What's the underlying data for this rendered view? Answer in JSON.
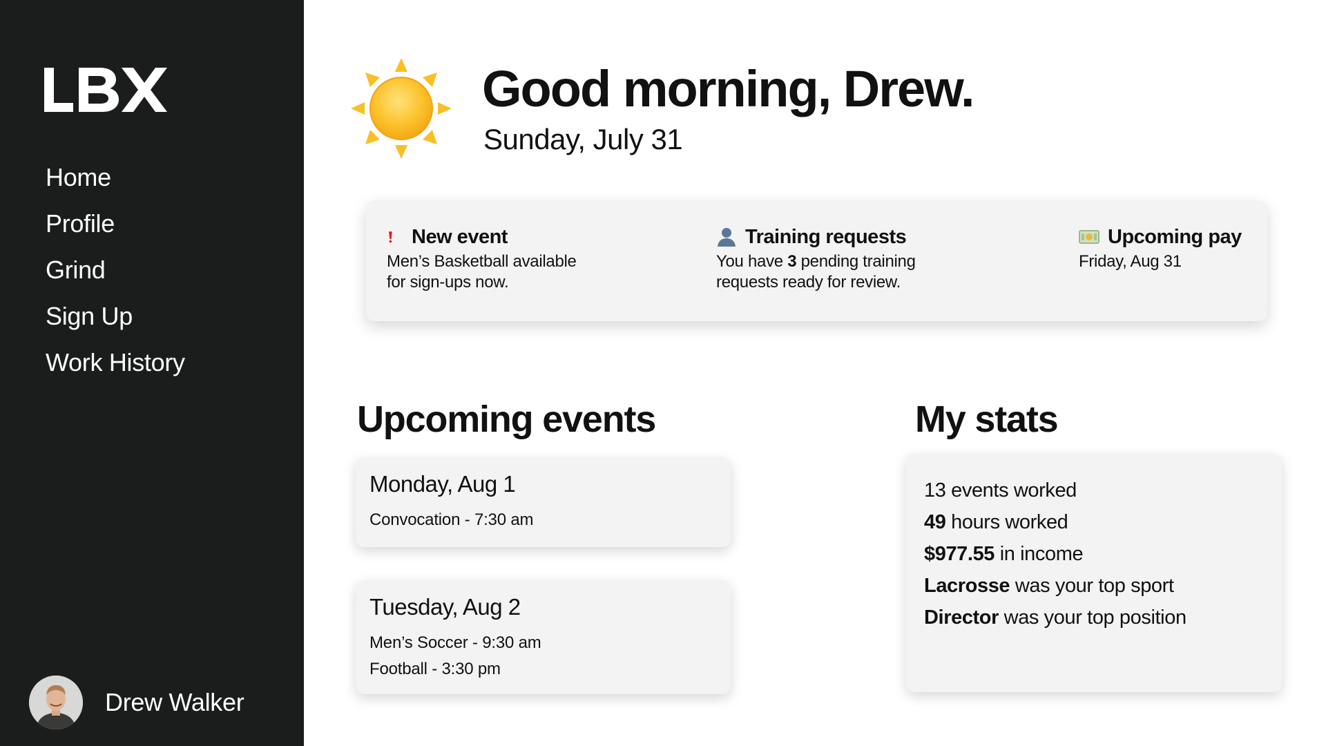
{
  "sidebar": {
    "logo": "LBX",
    "nav": [
      {
        "label": "Home",
        "icon": ""
      },
      {
        "label": "Profile",
        "icon": ""
      },
      {
        "label": "Grind",
        "icon": ""
      },
      {
        "label": "Sign Up",
        "icon": ""
      },
      {
        "label": "Work History",
        "icon": ""
      }
    ],
    "user": {
      "name": "Drew Walker",
      "avatar_icon": "user-avatar"
    }
  },
  "header": {
    "greeting": "Good morning, Drew.",
    "date": "Sunday, July 31",
    "weather_icon": "sun-icon"
  },
  "alerts": {
    "new_event": {
      "icon": "exclamation-icon",
      "title": "New event",
      "body_line1": "Men’s Basketball available",
      "body_line2": "for sign-ups now."
    },
    "training": {
      "icon": "person-icon",
      "title": "Training requests",
      "body_prefix": "You have ",
      "count": "3",
      "body_suffix": " pending training",
      "body_line2": "requests ready for review."
    },
    "pay": {
      "icon": "money-icon",
      "title": "Upcoming pay",
      "body": "Friday, Aug 31"
    }
  },
  "events": {
    "title": "Upcoming events",
    "items": [
      {
        "day": "Monday, Aug 1",
        "lines": [
          "Convocation - 7:30 am"
        ]
      },
      {
        "day": "Tuesday, Aug 2",
        "lines": [
          "Men’s Soccer - 9:30 am",
          "Football - 3:30 pm"
        ]
      }
    ]
  },
  "stats": {
    "title": "My stats",
    "items": [
      {
        "value": "13",
        "text": " events worked",
        "bold": false
      },
      {
        "value": "49",
        "text": " hours worked",
        "bold": true
      },
      {
        "value": "$977.55",
        "text": " in income",
        "bold": true
      },
      {
        "value": "Lacrosse",
        "text": " was your top sport",
        "bold": true
      },
      {
        "value": "Director",
        "text": " was your top position",
        "bold": true
      }
    ]
  },
  "colors": {
    "sidebar_bg": "#1b1d1c",
    "card_bg": "#f3f3f3",
    "alert_red": "#e02020",
    "sun_yellow": "#f8c12e"
  }
}
